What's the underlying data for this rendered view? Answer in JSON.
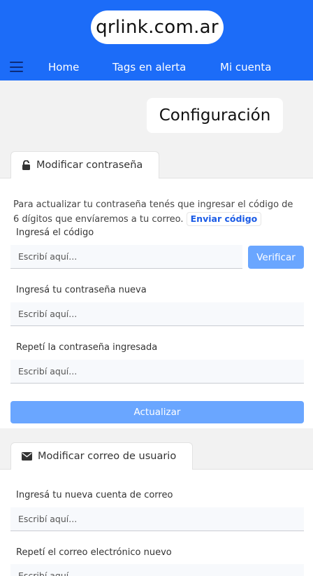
{
  "header": {
    "logo": "qrlink.com.ar",
    "nav": {
      "home": "Home",
      "tags_alert": "Tags en alerta",
      "account": "Mi cuenta"
    }
  },
  "page_title": "Configuración",
  "password_section": {
    "tab_label": "Modificar contraseña",
    "description": "Para actualizar tu contraseña tenés que ingresar el código de 6 dígitos que envíaremos a tu correo.",
    "send_code_label": "Enviar código",
    "code_label": "Ingresá el código",
    "code_placeholder": "Escribí aquí...",
    "verify_label": "Verificar",
    "new_password_label": "Ingresá tu contraseña nueva",
    "new_password_placeholder": "Escribí aquí...",
    "repeat_password_label": "Repetí la contraseña ingresada",
    "repeat_password_placeholder": "Escribí aquí...",
    "update_label": "Actualizar"
  },
  "email_section": {
    "tab_label": "Modificar correo de usuario",
    "new_email_label": "Ingresá tu nueva cuenta de correo",
    "new_email_placeholder": "Escribí aquí...",
    "repeat_email_label": "Repetí el correo electrónico nuevo",
    "repeat_email_placeholder": "Escribí aquí..."
  },
  "colors": {
    "header": "#1c6cf8",
    "button": "#6aa6ff",
    "link": "#1a5be6"
  }
}
